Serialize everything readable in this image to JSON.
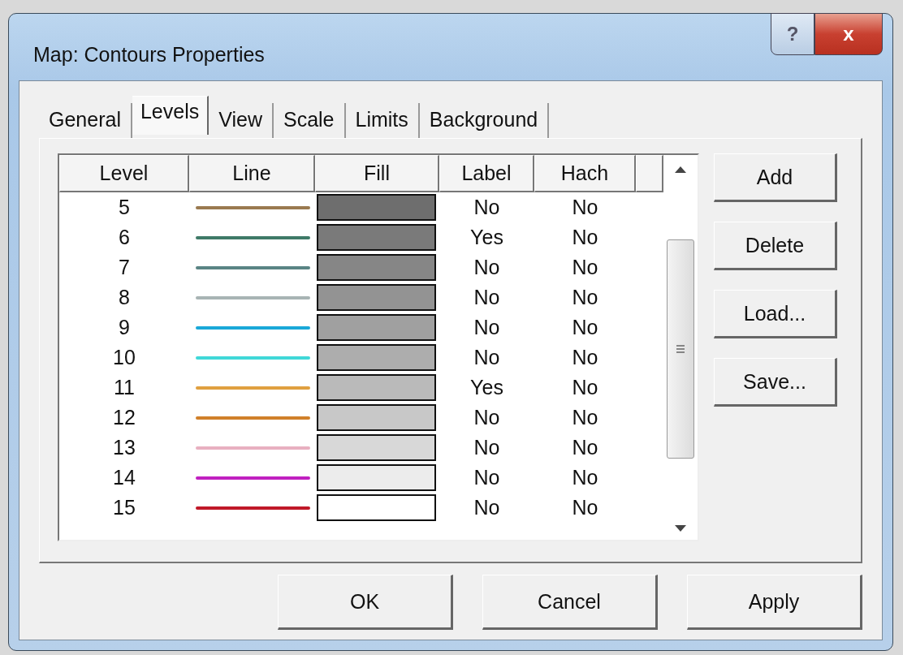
{
  "window": {
    "title": "Map: Contours Properties",
    "controls": [
      "?",
      "x"
    ]
  },
  "tabs": [
    {
      "label": "General",
      "selected": false
    },
    {
      "label": "Levels",
      "selected": true
    },
    {
      "label": "View",
      "selected": false
    },
    {
      "label": "Scale",
      "selected": false
    },
    {
      "label": "Limits",
      "selected": false
    },
    {
      "label": "Background",
      "selected": false
    }
  ],
  "table": {
    "columns": [
      "Level",
      "Line",
      "Fill",
      "Label",
      "Hach"
    ],
    "rows": [
      {
        "level": "5",
        "line": {
          "color": "#9a7a50"
        },
        "fill": {
          "color": "#6e6e6e"
        },
        "label": "No",
        "hach": "No"
      },
      {
        "level": "6",
        "line": {
          "color": "#3f7a68"
        },
        "fill": {
          "color": "#7a7a7a"
        },
        "label": "Yes",
        "hach": "No"
      },
      {
        "level": "7",
        "line": {
          "color": "#5a8484"
        },
        "fill": {
          "color": "#868686"
        },
        "label": "No",
        "hach": "No"
      },
      {
        "level": "8",
        "line": {
          "color": "#a8b4b4"
        },
        "fill": {
          "color": "#939393"
        },
        "label": "No",
        "hach": "No"
      },
      {
        "level": "9",
        "line": {
          "color": "#1aa8d8"
        },
        "fill": {
          "color": "#a0a0a0"
        },
        "label": "No",
        "hach": "No"
      },
      {
        "level": "10",
        "line": {
          "color": "#40d8d8"
        },
        "fill": {
          "color": "#adadad"
        },
        "label": "No",
        "hach": "No"
      },
      {
        "level": "11",
        "line": {
          "color": "#e0a040"
        },
        "fill": {
          "color": "#bababa"
        },
        "label": "Yes",
        "hach": "No"
      },
      {
        "level": "12",
        "line": {
          "color": "#d0802a"
        },
        "fill": {
          "color": "#c8c8c8"
        },
        "label": "No",
        "hach": "No"
      },
      {
        "level": "13",
        "line": {
          "color": "#e8b0c0"
        },
        "fill": {
          "color": "#d8d8d8"
        },
        "label": "No",
        "hach": "No"
      },
      {
        "level": "14",
        "line": {
          "color": "#c020c0"
        },
        "fill": {
          "color": "#ececec"
        },
        "label": "No",
        "hach": "No"
      },
      {
        "level": "15",
        "line": {
          "color": "#c01828"
        },
        "fill": {
          "color": "#ffffff"
        },
        "label": "No",
        "hach": "No"
      }
    ]
  },
  "side_buttons": [
    "Add",
    "Delete",
    "Load...",
    "Save..."
  ],
  "buttons": [
    "OK",
    "Cancel",
    "Apply"
  ]
}
